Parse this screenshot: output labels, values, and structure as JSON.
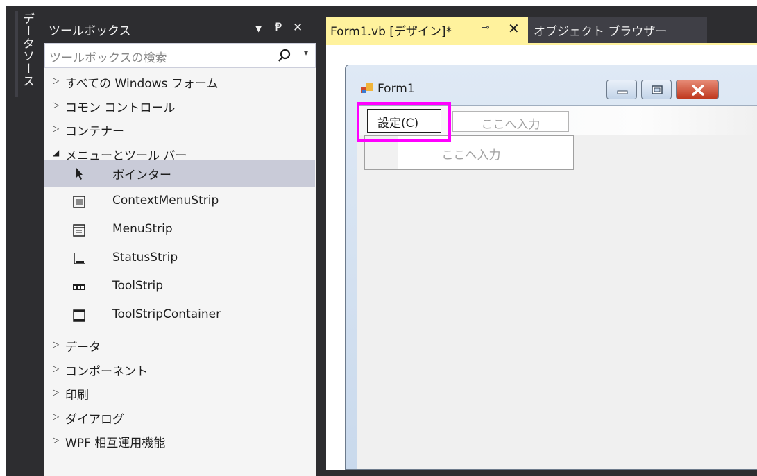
{
  "data_source_tab": {
    "label": "データソース"
  },
  "toolbox": {
    "title": "ツールボックス",
    "header_buttons": {
      "dropdown": "▼",
      "pin": "Ᵽ",
      "close": "✕"
    },
    "search_placeholder": "ツールボックスの検索",
    "categories_top": [
      {
        "label": "すべての Windows フォーム",
        "expanded": false
      },
      {
        "label": "コモン コントロール",
        "expanded": false
      },
      {
        "label": "コンテナー",
        "expanded": false
      },
      {
        "label": "メニューとツール バー",
        "expanded": true
      }
    ],
    "menu_items": [
      {
        "label": "ポインター",
        "icon": "pointer-icon",
        "selected": true
      },
      {
        "label": "ContextMenuStrip",
        "icon": "context-menu-strip-icon",
        "selected": false
      },
      {
        "label": "MenuStrip",
        "icon": "menu-strip-icon",
        "selected": false
      },
      {
        "label": "StatusStrip",
        "icon": "status-strip-icon",
        "selected": false
      },
      {
        "label": "ToolStrip",
        "icon": "tool-strip-icon",
        "selected": false
      },
      {
        "label": "ToolStripContainer",
        "icon": "tool-strip-container-icon",
        "selected": false
      }
    ],
    "categories_bottom": [
      {
        "label": "データ",
        "expanded": false
      },
      {
        "label": "コンポーネント",
        "expanded": false
      },
      {
        "label": "印刷",
        "expanded": false
      },
      {
        "label": "ダイアログ",
        "expanded": false
      },
      {
        "label": "WPF 相互運用機能",
        "expanded": false
      }
    ]
  },
  "tabs": {
    "active": {
      "label": "Form1.vb [デザイン]*",
      "pin": "⊸",
      "close": "✕"
    },
    "inactive": {
      "label": "オブジェクト ブラウザー"
    }
  },
  "form": {
    "title": "Form1",
    "menu": {
      "item_label": "設定(C)",
      "type_here_top": "ここへ入力",
      "type_here_dropdown": "ここへ入力"
    }
  },
  "colors": {
    "frame_dark": "#2d2d30",
    "active_tab": "#fff29d",
    "selected_row": "#c9cbd8",
    "highlight": "#ff00ff"
  }
}
